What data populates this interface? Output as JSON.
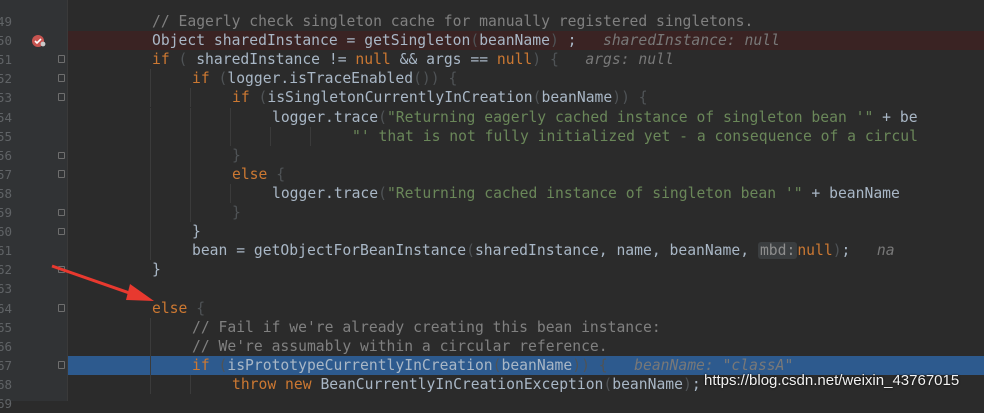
{
  "editor": {
    "line_numbers": [
      "49",
      "50",
      "51",
      "52",
      "53",
      "54",
      "55",
      "56",
      "57",
      "58",
      "59",
      "60",
      "61",
      "62",
      "63",
      "64",
      "65",
      "66",
      "67",
      "68",
      "69"
    ],
    "lines": [
      {
        "parts": [
          [
            "cm",
            "// Eagerly check singleton cache for manually registered singletons."
          ]
        ]
      },
      {
        "parts": [
          [
            "ty",
            "Object "
          ],
          [
            "pl",
            "sharedInstance = getSingleton"
          ],
          [
            "dim",
            "("
          ],
          [
            "pl",
            "beanName"
          ],
          [
            "dim",
            ")"
          ],
          [
            "pl",
            " ;   "
          ],
          [
            "inl",
            "sharedInstance: null"
          ]
        ]
      },
      {
        "parts": [
          [
            "kw",
            "if "
          ],
          [
            "dim",
            "("
          ],
          [
            "pl",
            " sharedInstance != "
          ],
          [
            "kw",
            "null"
          ],
          [
            "pl",
            " && args == "
          ],
          [
            "kw",
            "null"
          ],
          [
            "dim",
            ") {"
          ],
          [
            "pl",
            "   "
          ],
          [
            "inl",
            "args: null"
          ]
        ]
      },
      {
        "parts": [
          [
            "kw",
            "if "
          ],
          [
            "dim",
            "("
          ],
          [
            "pl",
            "logger.isTraceEnabled"
          ],
          [
            "dim",
            "()) {"
          ]
        ]
      },
      {
        "parts": [
          [
            "kw",
            "if "
          ],
          [
            "dim",
            "("
          ],
          [
            "pl",
            "isSingletonCurrentlyInCreation"
          ],
          [
            "dim",
            "("
          ],
          [
            "pl",
            "beanName"
          ],
          [
            "dim",
            ")) {"
          ]
        ]
      },
      {
        "parts": [
          [
            "pl",
            "logger.trace"
          ],
          [
            "dim",
            "("
          ],
          [
            "str",
            "\"Returning eagerly cached instance of singleton bean '\""
          ],
          [
            "pl",
            " + be"
          ]
        ]
      },
      {
        "parts": [
          [
            "str",
            "\"' that is not fully initialized yet - a consequence of a circul"
          ]
        ]
      },
      {
        "parts": [
          [
            "dim",
            "}"
          ]
        ]
      },
      {
        "parts": [
          [
            "kw",
            "else "
          ],
          [
            "dim",
            "{"
          ]
        ]
      },
      {
        "parts": [
          [
            "pl",
            "logger.trace"
          ],
          [
            "dim",
            "("
          ],
          [
            "str",
            "\"Returning cached instance of singleton bean '\""
          ],
          [
            "pl",
            " + beanName"
          ]
        ]
      },
      {
        "parts": [
          [
            "dim",
            "}"
          ]
        ]
      },
      {
        "parts": [
          [
            "pl",
            "}"
          ]
        ]
      },
      {
        "parts": [
          [
            "pl",
            "bean = getObjectForBeanInstance"
          ],
          [
            "dim",
            "("
          ],
          [
            "pl",
            "sharedInstance, name, beanName, "
          ],
          [
            "hint",
            "mbd:"
          ],
          [
            "kw",
            "null"
          ],
          [
            "dim",
            ")"
          ],
          [
            "pl",
            ";   "
          ],
          [
            "inl",
            "na"
          ]
        ]
      },
      {
        "parts": [
          [
            "pl",
            "}"
          ]
        ]
      },
      {
        "parts": []
      },
      {
        "parts": [
          [
            "kw",
            "else "
          ],
          [
            "dim",
            "{"
          ]
        ]
      },
      {
        "parts": [
          [
            "cm",
            "// Fail if we're already creating this bean instance:"
          ]
        ]
      },
      {
        "parts": [
          [
            "cm",
            "// We're assumably within a circular reference."
          ]
        ]
      },
      {
        "parts": [
          [
            "kw",
            "if "
          ],
          [
            "dim",
            "("
          ],
          [
            "pl",
            "isPrototypeCurrentlyInCreation"
          ],
          [
            "dim",
            "("
          ],
          [
            "pl",
            "beanName"
          ],
          [
            "dim",
            ")) {"
          ],
          [
            "pl",
            "   "
          ],
          [
            "inl",
            "beanName: \"classA\""
          ]
        ]
      },
      {
        "parts": [
          [
            "kw",
            "throw new "
          ],
          [
            "pl",
            "BeanCurrentlyInCreationException"
          ],
          [
            "dim",
            "("
          ],
          [
            "pl",
            "beanName"
          ],
          [
            "dim",
            ")"
          ],
          [
            "pl",
            ";"
          ]
        ]
      },
      {
        "parts": []
      }
    ]
  },
  "watermark": "https://blog.csdn.net/weixin_43767015",
  "colors": {
    "keyword": "#cc7832",
    "comment": "#808080",
    "string": "#6a8759",
    "exec_line": "#2d5a8e",
    "breakpoint_line": "#3a2323",
    "arrow": "#e8392f"
  }
}
